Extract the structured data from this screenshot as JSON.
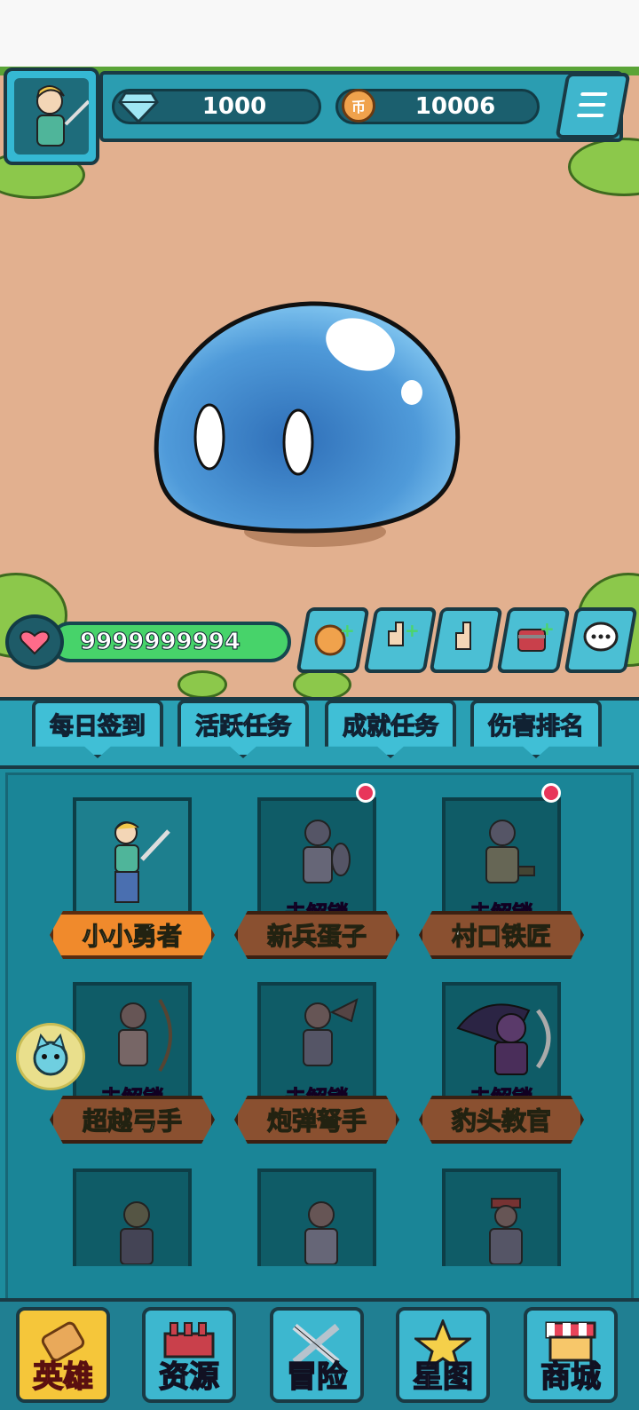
{
  "header": {
    "diamonds": "1000",
    "coins": "10006",
    "coin_glyph": "币"
  },
  "enemy": {
    "hp": "9999999994"
  },
  "tabs": [
    "每日签到",
    "活跃任务",
    "成就任务",
    "伤害排名"
  ],
  "heroes": [
    {
      "name": "小小勇者",
      "status": "",
      "unlocked": true,
      "dot": false
    },
    {
      "name": "新兵蛋子",
      "status": "未解锁",
      "unlocked": false,
      "dot": true
    },
    {
      "name": "村口铁匠",
      "status": "未解锁",
      "unlocked": false,
      "dot": true
    },
    {
      "name": "超越弓手",
      "status": "未解锁",
      "unlocked": false,
      "dot": false
    },
    {
      "name": "炮弹弩手",
      "status": "未解锁",
      "unlocked": false,
      "dot": false
    },
    {
      "name": "豹头教官",
      "status": "未解锁",
      "unlocked": false,
      "dot": false
    }
  ],
  "bottom_nav": [
    "英雄",
    "资源",
    "冒险",
    "星图",
    "商城"
  ],
  "colors": {
    "accent": "#2b9db1",
    "hp": "#47d36a",
    "active_tab": "#f5c63a"
  }
}
